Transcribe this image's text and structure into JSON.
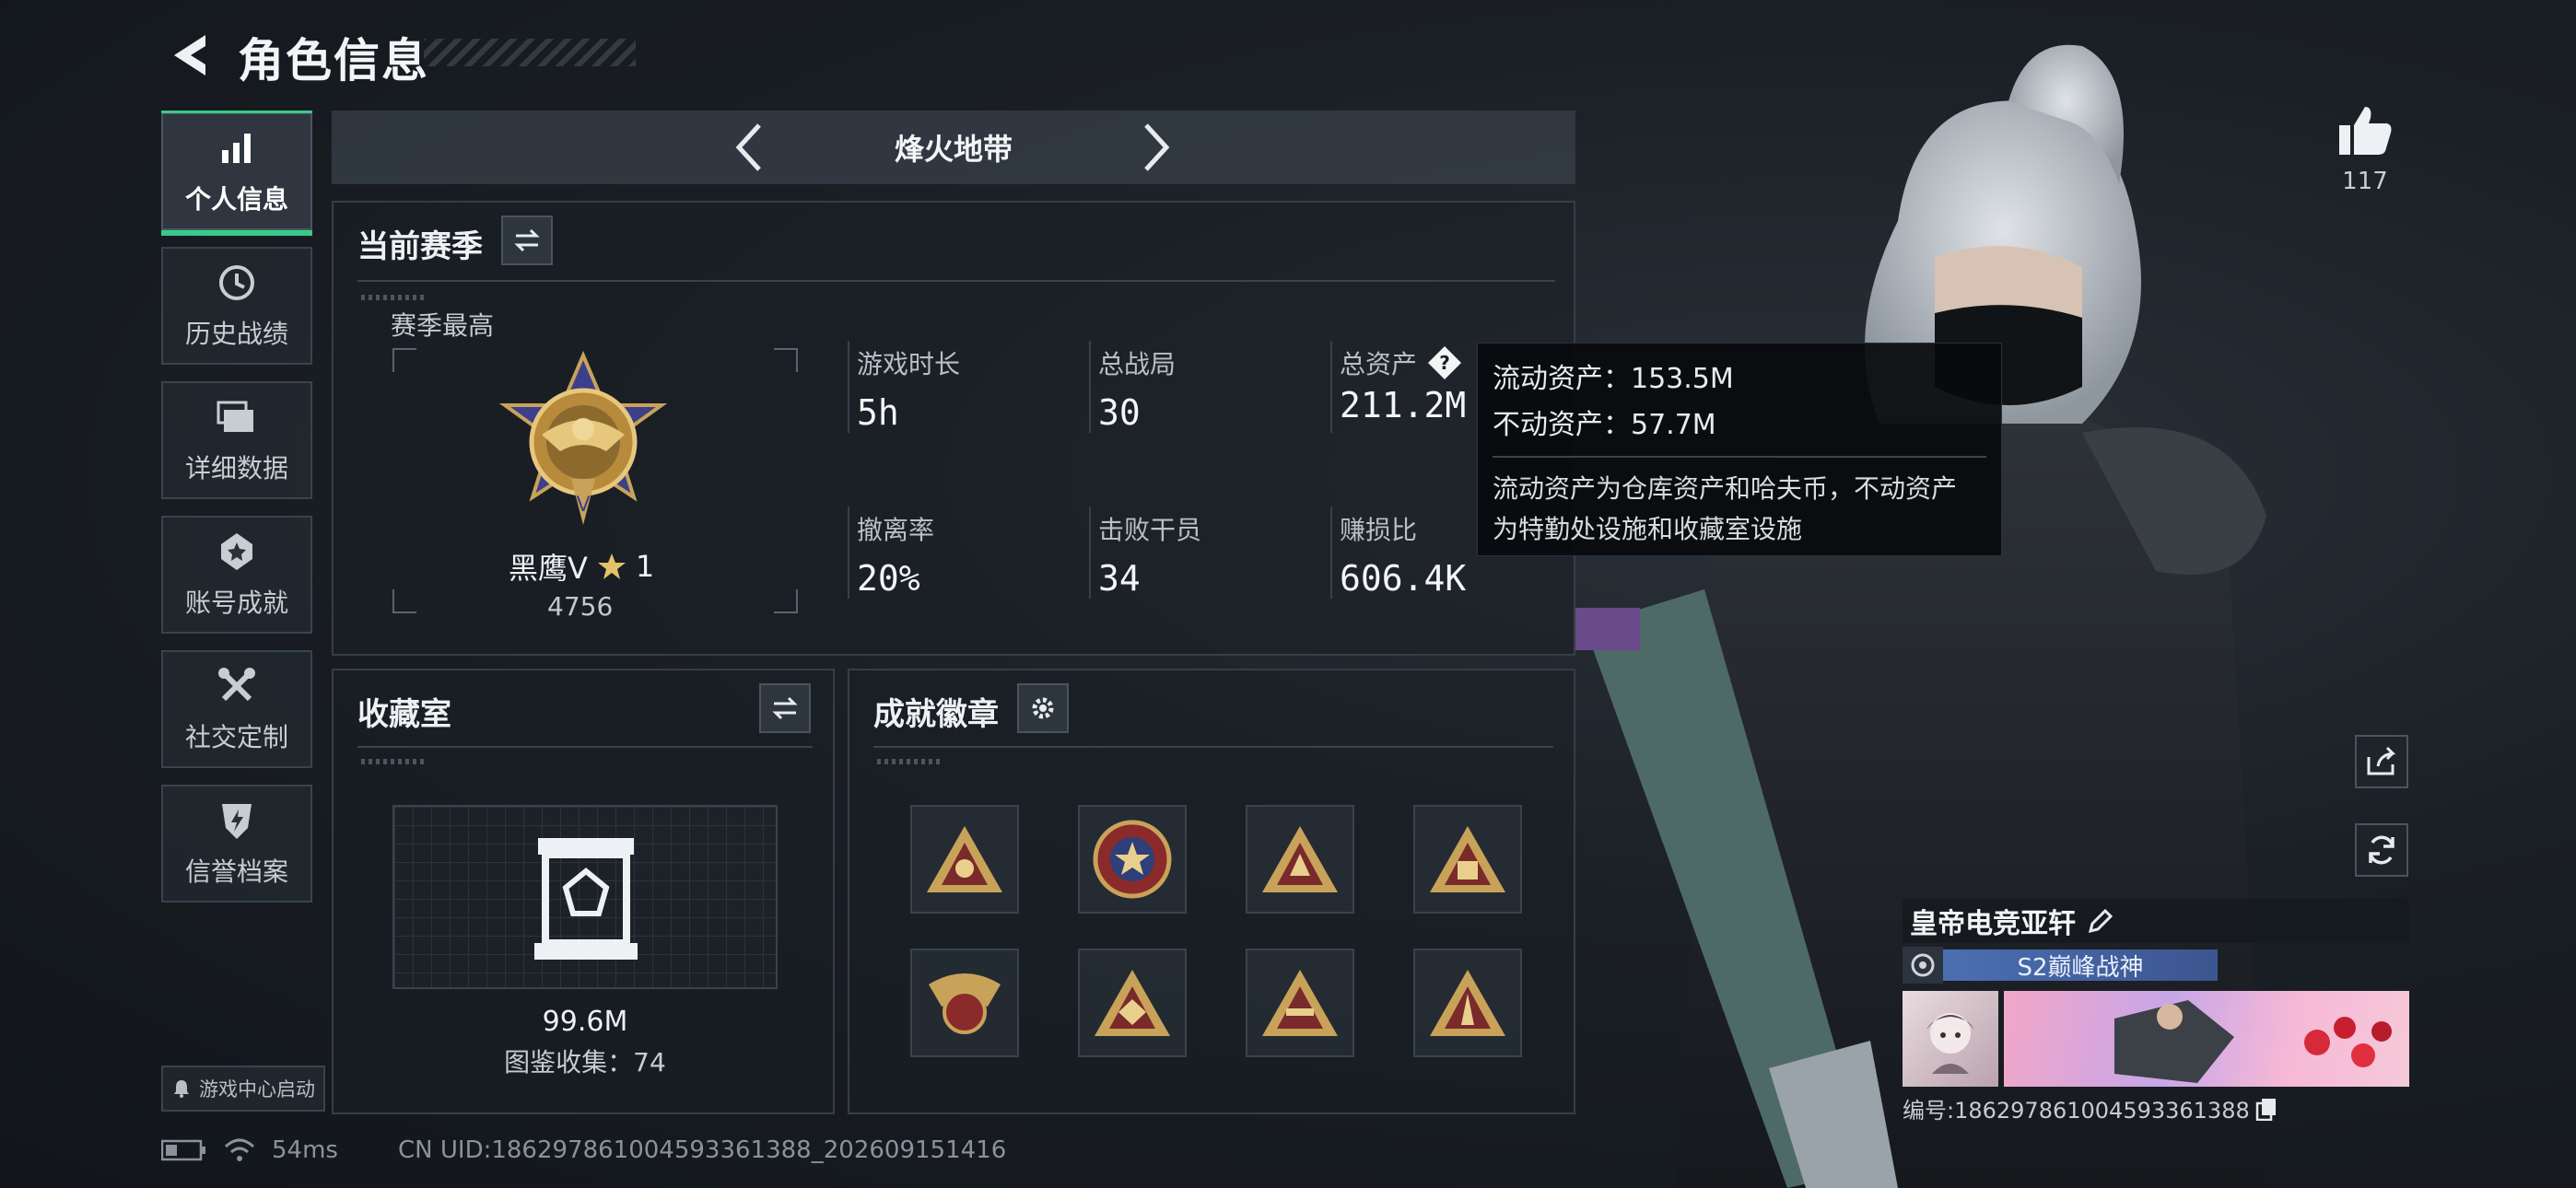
{
  "header": {
    "title": "角色信息",
    "back_icon": "back-arrow-icon"
  },
  "sidebar": {
    "items": [
      {
        "label": "个人信息",
        "icon": "bar-chart-icon",
        "active": true
      },
      {
        "label": "历史战绩",
        "icon": "clock-icon",
        "active": false
      },
      {
        "label": "详细数据",
        "icon": "folder-stack-icon",
        "active": false
      },
      {
        "label": "账号成就",
        "icon": "medal-star-icon",
        "active": false
      },
      {
        "label": "社交定制",
        "icon": "wrench-tools-icon",
        "active": false
      },
      {
        "label": "信誉档案",
        "icon": "shield-bolt-icon",
        "active": false
      }
    ],
    "launch_label": "游戏中心启动"
  },
  "mode": {
    "title": "烽火地带"
  },
  "season": {
    "title": "当前赛季",
    "best_label": "赛季最高",
    "rank_name": "黑鹰V",
    "rank_stars": "1",
    "rank_score": "4756",
    "stats": [
      {
        "label": "游戏时长",
        "value": "5h"
      },
      {
        "label": "总战局",
        "value": "30"
      },
      {
        "label": "总资产",
        "value": "211.2M"
      },
      {
        "label": "撤离率",
        "value": "20%"
      },
      {
        "label": "击败干员",
        "value": "34"
      },
      {
        "label": "赚损比",
        "value": "606.4K"
      }
    ]
  },
  "tooltip": {
    "liquid": "流动资产：153.5M",
    "fixed": "不动资产：57.7M",
    "desc_1": "流动资产为仓库资产和哈夫币，不动资产",
    "desc_2": "为特勤处设施和收藏室设施"
  },
  "collection": {
    "title": "收藏室",
    "value": "99.6M",
    "count": "图鉴收集：74"
  },
  "achievements": {
    "title": "成就徽章",
    "badge_count": 8
  },
  "likes": {
    "count": "117"
  },
  "profile": {
    "name": "皇帝电竞亚轩",
    "title_badge": "S2巅峰战神",
    "id_text": "编号:1862978610045933613​88"
  },
  "status": {
    "ping": "54ms",
    "uid": "CN UID:1862978610045933613​88_202609151416"
  },
  "colors": {
    "accent": "#39c98a",
    "panel_border": "#353e47",
    "gold": "#c9a25a"
  }
}
